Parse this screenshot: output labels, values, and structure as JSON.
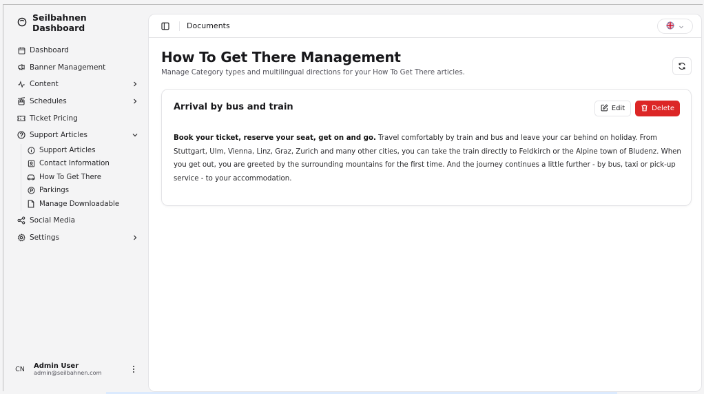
{
  "sidebar": {
    "brand": "Seilbahnen Dashboard",
    "items": [
      {
        "label": "Dashboard",
        "icon": "calendar-icon"
      },
      {
        "label": "Banner Management",
        "icon": "megaphone-icon"
      },
      {
        "label": "Content",
        "icon": "activity-icon"
      },
      {
        "label": "Schedules",
        "icon": "cable-car-icon"
      },
      {
        "label": "Ticket Pricing",
        "icon": "ticket-icon"
      },
      {
        "label": "Support Articles",
        "icon": "help-circle-icon"
      },
      {
        "label": "Social Media",
        "icon": "share-icon"
      },
      {
        "label": "Settings",
        "icon": "gear-icon"
      }
    ],
    "support_sub": [
      {
        "label": "Support Articles",
        "icon": "info-icon"
      },
      {
        "label": "Contact Information",
        "icon": "contact-icon"
      },
      {
        "label": "How To Get There",
        "icon": "car-icon"
      },
      {
        "label": "Parkings",
        "icon": "parking-icon"
      },
      {
        "label": "Manage Downloadable",
        "icon": "file-icon"
      }
    ],
    "user": {
      "initials": "CN",
      "name": "Admin User",
      "email": "admin@seilbahnen.com"
    }
  },
  "topbar": {
    "breadcrumb": "Documents",
    "language_flag": "uk-flag-icon"
  },
  "page": {
    "title": "How To Get There Management",
    "subtitle": "Manage Category types and multilingual directions for your How To Get There articles."
  },
  "card": {
    "title": "Arrival by bus and train",
    "edit_label": "Edit",
    "delete_label": "Delete",
    "body_bold": "Book your ticket, reserve your seat, get on and go.",
    "body_text": " Travel comfortably by train and bus and leave your car behind on holiday. From Stuttgart, Ulm, Vienna, Linz, Graz, Zurich and many other cities, you can take the train directly to Feldkirch or the Alpine town of Bludenz. When you get out, you are greeted by the surrounding mountains for the first time. And the journey continues a little further - by bus, taxi or pick-up service - to your accommodation."
  },
  "colors": {
    "delete": "#dc2626",
    "border": "#e4e4e7",
    "background": "#f4f4f5"
  }
}
